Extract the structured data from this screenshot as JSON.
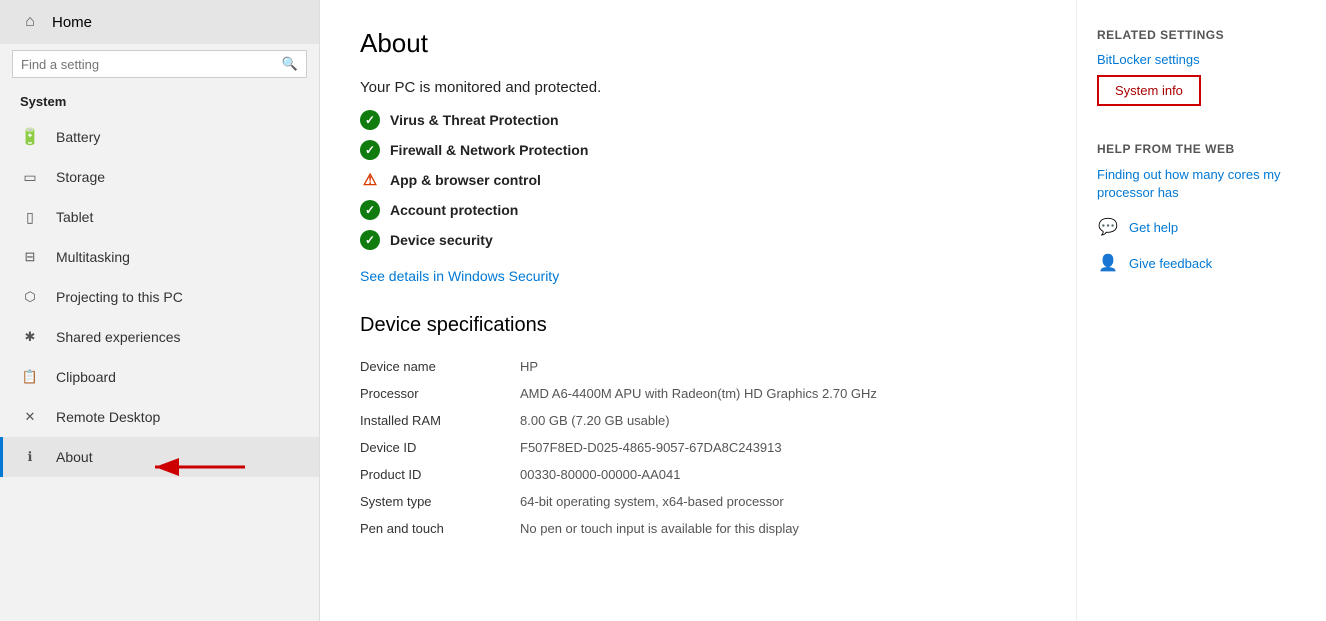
{
  "sidebar": {
    "home_label": "Home",
    "search_placeholder": "Find a setting",
    "section_title": "System",
    "items": [
      {
        "id": "battery",
        "label": "Battery",
        "icon": "🔋"
      },
      {
        "id": "storage",
        "label": "Storage",
        "icon": "💾"
      },
      {
        "id": "tablet",
        "label": "Tablet",
        "icon": "📱"
      },
      {
        "id": "multitasking",
        "label": "Multitasking",
        "icon": "⊟"
      },
      {
        "id": "projecting",
        "label": "Projecting to this PC",
        "icon": "📽"
      },
      {
        "id": "shared",
        "label": "Shared experiences",
        "icon": "🔗"
      },
      {
        "id": "clipboard",
        "label": "Clipboard",
        "icon": "📋"
      },
      {
        "id": "remote",
        "label": "Remote Desktop",
        "icon": "✕"
      },
      {
        "id": "about",
        "label": "About",
        "icon": "ℹ"
      }
    ]
  },
  "main": {
    "page_title": "About",
    "protection_header": "Your PC is monitored and protected.",
    "protection_items": [
      {
        "id": "virus",
        "label": "Virus & Threat Protection",
        "status": "ok"
      },
      {
        "id": "firewall",
        "label": "Firewall & Network Protection",
        "status": "ok"
      },
      {
        "id": "app_browser",
        "label": "App & browser control",
        "status": "warn"
      },
      {
        "id": "account",
        "label": "Account protection",
        "status": "ok"
      },
      {
        "id": "device_security",
        "label": "Device security",
        "status": "ok"
      }
    ],
    "see_details_link": "See details in Windows Security",
    "device_specs_title": "Device specifications",
    "specs": [
      {
        "label": "Device name",
        "value": "HP"
      },
      {
        "label": "Processor",
        "value": "AMD A6-4400M APU with Radeon(tm) HD Graphics    2.70 GHz"
      },
      {
        "label": "Installed RAM",
        "value": "8.00 GB (7.20 GB usable)"
      },
      {
        "label": "Device ID",
        "value": "F507F8ED-D025-4865-9057-67DA8C243913"
      },
      {
        "label": "Product ID",
        "value": "00330-80000-00000-AA041"
      },
      {
        "label": "System type",
        "value": "64-bit operating system, x64-based processor"
      },
      {
        "label": "Pen and touch",
        "value": "No pen or touch input is available for this display"
      }
    ]
  },
  "right_panel": {
    "related_title": "Related settings",
    "bitlocker_link": "BitLocker settings",
    "system_info_label": "System info",
    "help_title": "Help from the web",
    "help_link": "Finding out how many cores my processor has",
    "get_help_label": "Get help",
    "give_feedback_label": "Give feedback"
  }
}
